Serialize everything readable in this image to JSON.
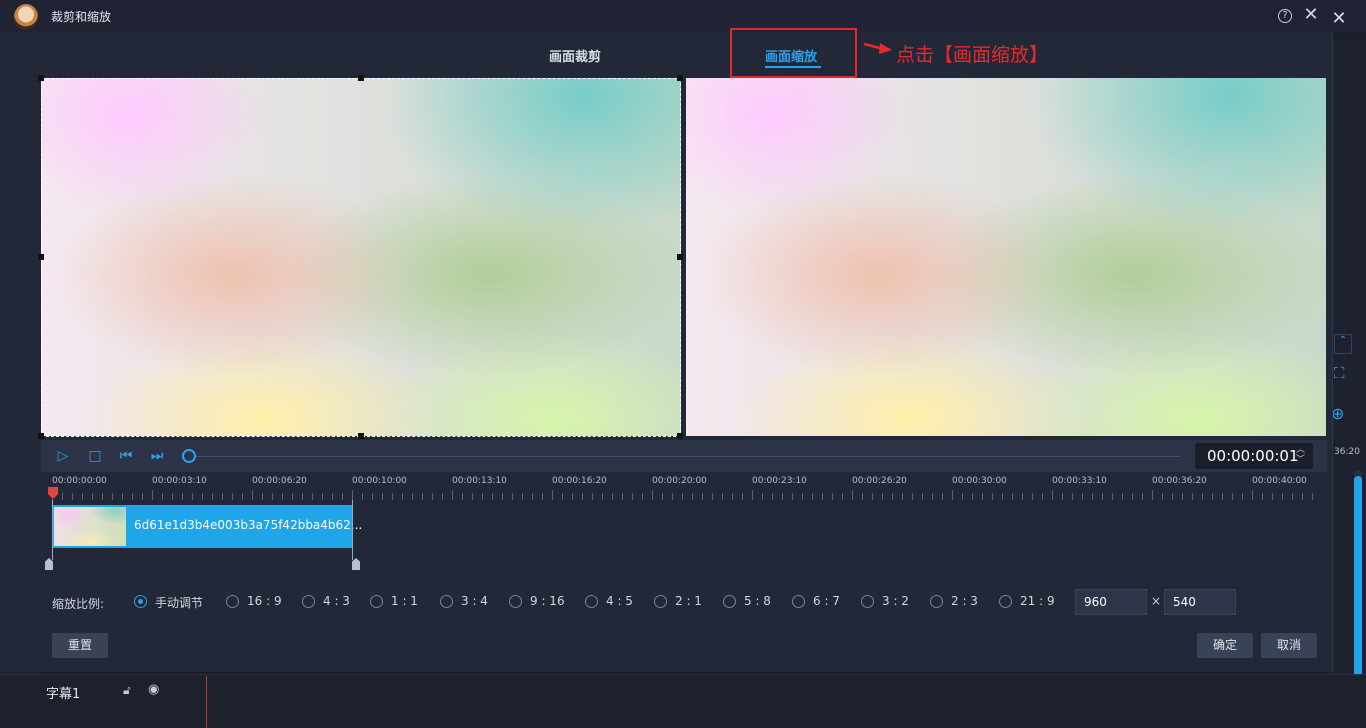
{
  "window": {
    "title": "裁剪和缩放"
  },
  "tabs": [
    {
      "label": "画面裁剪",
      "active": false
    },
    {
      "label": "画面缩放",
      "active": true
    }
  ],
  "annotation": {
    "text": "点击【画面缩放】",
    "color": "#e82a2a"
  },
  "player": {
    "timecode": "00:00:00:01",
    "progress": 0
  },
  "ruler": {
    "labels": [
      "00:00:00:00",
      "00:00:03:10",
      "00:00:06:20",
      "00:00:10:00",
      "00:00:13:10",
      "00:00:16:20",
      "00:00:20:00",
      "00:00:23:10",
      "00:00:26:20",
      "00:00:30:00",
      "00:00:33:10",
      "00:00:36:20",
      "00:00:40:00"
    ]
  },
  "clip": {
    "name": "6d61e1d3b4e003b3a75f42bba4b62..."
  },
  "zoom_ratio": {
    "label": "缩放比例:",
    "options": [
      "手动调节",
      "16 : 9",
      "4 : 3",
      "1 : 1",
      "3 : 4",
      "9 : 16",
      "4 : 5",
      "2 : 1",
      "5 : 8",
      "6 : 7",
      "3 : 2",
      "2 : 3",
      "21 : 9"
    ],
    "selected": "手动调节",
    "width": "960",
    "height": "540",
    "times": "×"
  },
  "buttons": {
    "reset": "重置",
    "ok": "确定",
    "cancel": "取消"
  },
  "background_app": {
    "subtitle_track": "字幕1",
    "right_time": "36:20"
  },
  "colors": {
    "accent": "#2aa3ee",
    "clip": "#1fa6e9",
    "highlight": "#e02a2a"
  }
}
